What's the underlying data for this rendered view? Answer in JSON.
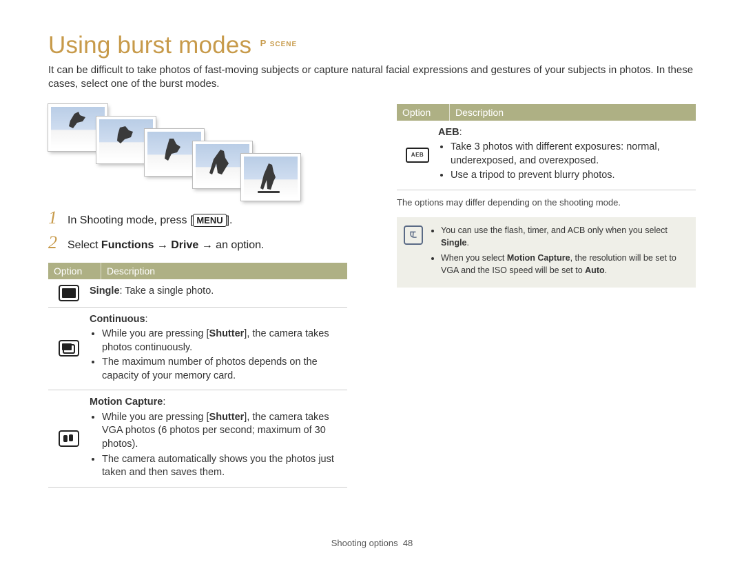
{
  "title": "Using burst modes",
  "mode_tag_p": "P",
  "mode_tag_scene": "SCENE",
  "intro": "It can be difficult to take photos of fast-moving subjects or capture natural facial expressions and gestures of your subjects in photos. In these cases, select one of the burst modes.",
  "steps": {
    "s1_num": "1",
    "s1_pre": "In Shooting mode, press [",
    "s1_menu": "MENU",
    "s1_post": "].",
    "s2_num": "2",
    "s2_pre": "Select ",
    "s2_func": "Functions",
    "s2_arrow1": " → ",
    "s2_drive": "Drive",
    "s2_arrow2": " → an option."
  },
  "table_headers": {
    "option": "Option",
    "description": "Description"
  },
  "left_rows": {
    "single_title": "Single",
    "single_text": ": Take a single photo.",
    "cont_title": "Continuous",
    "cont_colon": ":",
    "cont_b1a": "While you are pressing [",
    "cont_b1b": "Shutter",
    "cont_b1c": "], the camera takes photos continuously.",
    "cont_b2": "The maximum number of photos depends on the capacity of your memory card.",
    "mc_title": "Motion Capture",
    "mc_colon": ":",
    "mc_b1a": "While you are pressing [",
    "mc_b1b": "Shutter",
    "mc_b1c": "], the camera takes VGA photos (6 photos per second; maximum of 30 photos).",
    "mc_b2": "The camera automatically shows you the photos just taken and then saves them."
  },
  "right_rows": {
    "aeb_title": "AEB",
    "aeb_colon": ":",
    "aeb_icon_text": "AEB",
    "aeb_b1": "Take 3 photos with different exposures: normal, underexposed, and overexposed.",
    "aeb_b2": "Use a tripod to prevent blurry photos."
  },
  "footnote": "The options may differ depending on the shooting mode.",
  "note": {
    "n1a": "You can use the flash, timer, and ACB only when you select ",
    "n1b": "Single",
    "n1c": ".",
    "n2a": "When you select ",
    "n2b": "Motion Capture",
    "n2c": ", the resolution will be set to VGA and the ISO speed will be set to ",
    "n2d": "Auto",
    "n2e": "."
  },
  "footer": {
    "section": "Shooting options",
    "page": "48"
  }
}
